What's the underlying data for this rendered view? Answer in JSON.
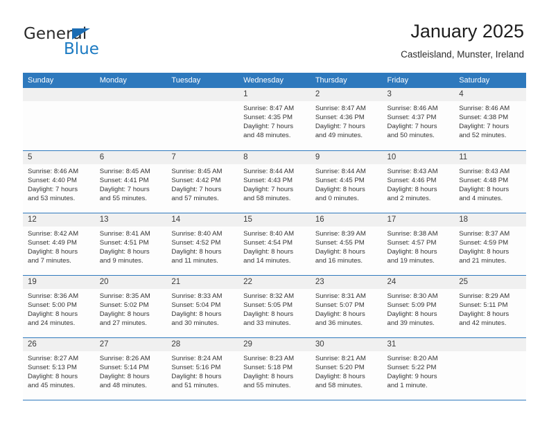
{
  "brand": {
    "name_part1": "General",
    "name_part2": "Blue",
    "accent_color": "#1b7ac2"
  },
  "header": {
    "title": "January 2025",
    "subtitle": "Castleisland, Munster, Ireland",
    "header_bg_color": "#2e79bd"
  },
  "weekday_headers": [
    "Sunday",
    "Monday",
    "Tuesday",
    "Wednesday",
    "Thursday",
    "Friday",
    "Saturday"
  ],
  "labels": {
    "sunrise_prefix": "Sunrise:",
    "sunset_prefix": "Sunset:",
    "daylight_prefix": "Daylight:"
  },
  "weeks": [
    [
      {
        "day": "",
        "empty": true
      },
      {
        "day": "",
        "empty": true
      },
      {
        "day": "",
        "empty": true
      },
      {
        "day": "1",
        "sunrise": "Sunrise: 8:47 AM",
        "sunset": "Sunset: 4:35 PM",
        "daylight1": "Daylight: 7 hours",
        "daylight2": "and 48 minutes."
      },
      {
        "day": "2",
        "sunrise": "Sunrise: 8:47 AM",
        "sunset": "Sunset: 4:36 PM",
        "daylight1": "Daylight: 7 hours",
        "daylight2": "and 49 minutes."
      },
      {
        "day": "3",
        "sunrise": "Sunrise: 8:46 AM",
        "sunset": "Sunset: 4:37 PM",
        "daylight1": "Daylight: 7 hours",
        "daylight2": "and 50 minutes."
      },
      {
        "day": "4",
        "sunrise": "Sunrise: 8:46 AM",
        "sunset": "Sunset: 4:38 PM",
        "daylight1": "Daylight: 7 hours",
        "daylight2": "and 52 minutes."
      }
    ],
    [
      {
        "day": "5",
        "sunrise": "Sunrise: 8:46 AM",
        "sunset": "Sunset: 4:40 PM",
        "daylight1": "Daylight: 7 hours",
        "daylight2": "and 53 minutes."
      },
      {
        "day": "6",
        "sunrise": "Sunrise: 8:45 AM",
        "sunset": "Sunset: 4:41 PM",
        "daylight1": "Daylight: 7 hours",
        "daylight2": "and 55 minutes."
      },
      {
        "day": "7",
        "sunrise": "Sunrise: 8:45 AM",
        "sunset": "Sunset: 4:42 PM",
        "daylight1": "Daylight: 7 hours",
        "daylight2": "and 57 minutes."
      },
      {
        "day": "8",
        "sunrise": "Sunrise: 8:44 AM",
        "sunset": "Sunset: 4:43 PM",
        "daylight1": "Daylight: 7 hours",
        "daylight2": "and 58 minutes."
      },
      {
        "day": "9",
        "sunrise": "Sunrise: 8:44 AM",
        "sunset": "Sunset: 4:45 PM",
        "daylight1": "Daylight: 8 hours",
        "daylight2": "and 0 minutes."
      },
      {
        "day": "10",
        "sunrise": "Sunrise: 8:43 AM",
        "sunset": "Sunset: 4:46 PM",
        "daylight1": "Daylight: 8 hours",
        "daylight2": "and 2 minutes."
      },
      {
        "day": "11",
        "sunrise": "Sunrise: 8:43 AM",
        "sunset": "Sunset: 4:48 PM",
        "daylight1": "Daylight: 8 hours",
        "daylight2": "and 4 minutes."
      }
    ],
    [
      {
        "day": "12",
        "sunrise": "Sunrise: 8:42 AM",
        "sunset": "Sunset: 4:49 PM",
        "daylight1": "Daylight: 8 hours",
        "daylight2": "and 7 minutes."
      },
      {
        "day": "13",
        "sunrise": "Sunrise: 8:41 AM",
        "sunset": "Sunset: 4:51 PM",
        "daylight1": "Daylight: 8 hours",
        "daylight2": "and 9 minutes."
      },
      {
        "day": "14",
        "sunrise": "Sunrise: 8:40 AM",
        "sunset": "Sunset: 4:52 PM",
        "daylight1": "Daylight: 8 hours",
        "daylight2": "and 11 minutes."
      },
      {
        "day": "15",
        "sunrise": "Sunrise: 8:40 AM",
        "sunset": "Sunset: 4:54 PM",
        "daylight1": "Daylight: 8 hours",
        "daylight2": "and 14 minutes."
      },
      {
        "day": "16",
        "sunrise": "Sunrise: 8:39 AM",
        "sunset": "Sunset: 4:55 PM",
        "daylight1": "Daylight: 8 hours",
        "daylight2": "and 16 minutes."
      },
      {
        "day": "17",
        "sunrise": "Sunrise: 8:38 AM",
        "sunset": "Sunset: 4:57 PM",
        "daylight1": "Daylight: 8 hours",
        "daylight2": "and 19 minutes."
      },
      {
        "day": "18",
        "sunrise": "Sunrise: 8:37 AM",
        "sunset": "Sunset: 4:59 PM",
        "daylight1": "Daylight: 8 hours",
        "daylight2": "and 21 minutes."
      }
    ],
    [
      {
        "day": "19",
        "sunrise": "Sunrise: 8:36 AM",
        "sunset": "Sunset: 5:00 PM",
        "daylight1": "Daylight: 8 hours",
        "daylight2": "and 24 minutes."
      },
      {
        "day": "20",
        "sunrise": "Sunrise: 8:35 AM",
        "sunset": "Sunset: 5:02 PM",
        "daylight1": "Daylight: 8 hours",
        "daylight2": "and 27 minutes."
      },
      {
        "day": "21",
        "sunrise": "Sunrise: 8:33 AM",
        "sunset": "Sunset: 5:04 PM",
        "daylight1": "Daylight: 8 hours",
        "daylight2": "and 30 minutes."
      },
      {
        "day": "22",
        "sunrise": "Sunrise: 8:32 AM",
        "sunset": "Sunset: 5:05 PM",
        "daylight1": "Daylight: 8 hours",
        "daylight2": "and 33 minutes."
      },
      {
        "day": "23",
        "sunrise": "Sunrise: 8:31 AM",
        "sunset": "Sunset: 5:07 PM",
        "daylight1": "Daylight: 8 hours",
        "daylight2": "and 36 minutes."
      },
      {
        "day": "24",
        "sunrise": "Sunrise: 8:30 AM",
        "sunset": "Sunset: 5:09 PM",
        "daylight1": "Daylight: 8 hours",
        "daylight2": "and 39 minutes."
      },
      {
        "day": "25",
        "sunrise": "Sunrise: 8:29 AM",
        "sunset": "Sunset: 5:11 PM",
        "daylight1": "Daylight: 8 hours",
        "daylight2": "and 42 minutes."
      }
    ],
    [
      {
        "day": "26",
        "sunrise": "Sunrise: 8:27 AM",
        "sunset": "Sunset: 5:13 PM",
        "daylight1": "Daylight: 8 hours",
        "daylight2": "and 45 minutes."
      },
      {
        "day": "27",
        "sunrise": "Sunrise: 8:26 AM",
        "sunset": "Sunset: 5:14 PM",
        "daylight1": "Daylight: 8 hours",
        "daylight2": "and 48 minutes."
      },
      {
        "day": "28",
        "sunrise": "Sunrise: 8:24 AM",
        "sunset": "Sunset: 5:16 PM",
        "daylight1": "Daylight: 8 hours",
        "daylight2": "and 51 minutes."
      },
      {
        "day": "29",
        "sunrise": "Sunrise: 8:23 AM",
        "sunset": "Sunset: 5:18 PM",
        "daylight1": "Daylight: 8 hours",
        "daylight2": "and 55 minutes."
      },
      {
        "day": "30",
        "sunrise": "Sunrise: 8:21 AM",
        "sunset": "Sunset: 5:20 PM",
        "daylight1": "Daylight: 8 hours",
        "daylight2": "and 58 minutes."
      },
      {
        "day": "31",
        "sunrise": "Sunrise: 8:20 AM",
        "sunset": "Sunset: 5:22 PM",
        "daylight1": "Daylight: 9 hours",
        "daylight2": "and 1 minute."
      },
      {
        "day": "",
        "empty": true
      }
    ]
  ]
}
